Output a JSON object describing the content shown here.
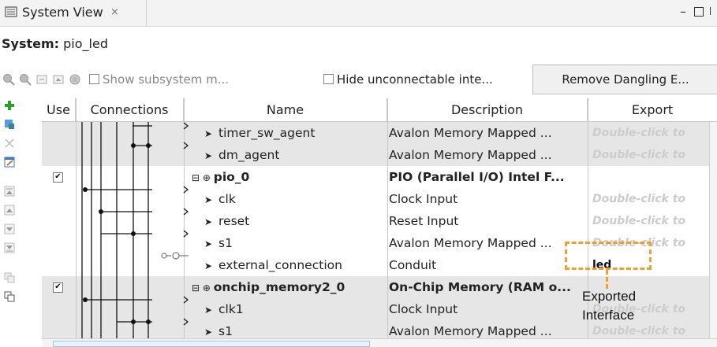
{
  "window": {
    "tab_title": "System View",
    "close_glyph": "×",
    "minimize_glyph": "–"
  },
  "system": {
    "label": "System:",
    "name": "pio_led"
  },
  "toolbar": {
    "show_subsystem_label": "Show subsystem m...",
    "hide_unconnectable_label": "Hide unconnectable inte...",
    "remove_dangling_label": "Remove Dangling E..."
  },
  "table": {
    "headers": {
      "use": "Use",
      "connections": "Connections",
      "name": "Name",
      "description": "Description",
      "export": "Export"
    },
    "rows": [
      {
        "name": "timer_sw_agent",
        "description": "Avalon Memory Mapped ...",
        "export": "Double-click to",
        "indent": 1,
        "shade": "gray",
        "use": ""
      },
      {
        "name": "dm_agent",
        "description": "Avalon Memory Mapped ...",
        "export": "Double-click to",
        "indent": 1,
        "shade": "gray",
        "use": ""
      },
      {
        "name": "pio_0",
        "description": "PIO (Parallel I/O) Intel F...",
        "export": "",
        "indent": 0,
        "shade": "white",
        "use": "✔"
      },
      {
        "name": "clk",
        "description": "Clock Input",
        "export": "Double-click to",
        "indent": 1,
        "shade": "white",
        "use": ""
      },
      {
        "name": "reset",
        "description": "Reset Input",
        "export": "Double-click to",
        "indent": 1,
        "shade": "white",
        "use": ""
      },
      {
        "name": "s1",
        "description": "Avalon Memory Mapped ...",
        "export": "Double-click to",
        "indent": 1,
        "shade": "white",
        "use": ""
      },
      {
        "name": "external_connection",
        "description": "Conduit",
        "export": "led",
        "indent": 1,
        "shade": "white",
        "use": ""
      },
      {
        "name": "onchip_memory2_0",
        "description": "On-Chip Memory (RAM o...",
        "export": "",
        "indent": 0,
        "shade": "gray",
        "use": "✔"
      },
      {
        "name": "clk1",
        "description": "Clock Input",
        "export": "Double-click to",
        "indent": 1,
        "shade": "gray",
        "use": ""
      },
      {
        "name": "s1",
        "description": "Avalon Memory Mapped ...",
        "export": "Double-click to",
        "indent": 1,
        "shade": "gray",
        "use": ""
      }
    ]
  },
  "callout": {
    "line1": "Exported",
    "line2": "Interface",
    "color": "#f0a030"
  }
}
